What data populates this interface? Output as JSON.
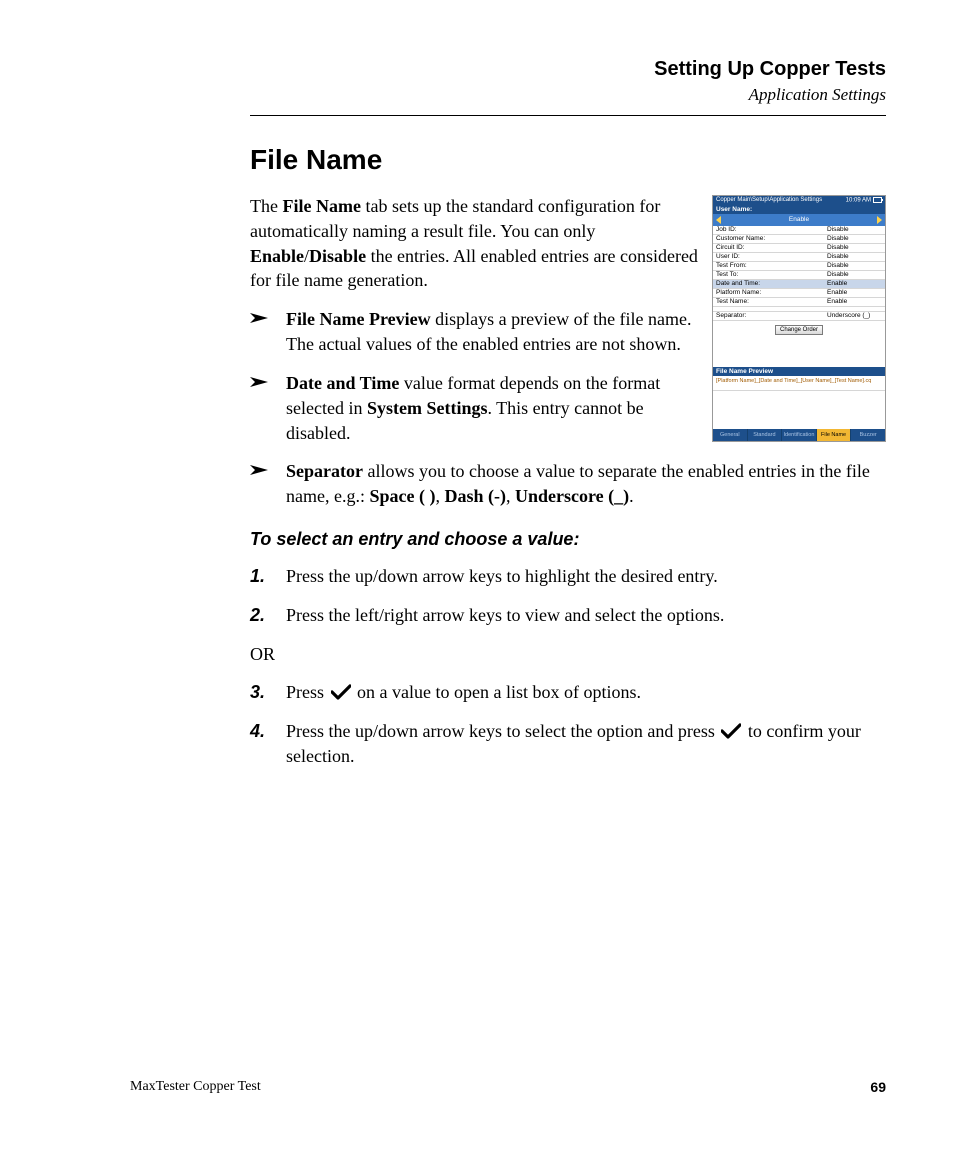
{
  "header": {
    "title": "Setting Up Copper Tests",
    "subtitle": "Application Settings"
  },
  "heading": "File Name",
  "intro": {
    "pre": "The ",
    "b1": "File Name",
    "mid1": " tab sets up the standard configuration for automatically naming a result file. You can only ",
    "b2": "Enable",
    "slash": "/",
    "b3": "Disable",
    "post": " the entries. All enabled entries are considered for file name generation."
  },
  "bullets": [
    {
      "b": "File Name Preview",
      "rest": " displays a preview of the file name. The actual values of the enabled entries are not shown."
    },
    {
      "b": "Date and Time",
      "mid": " value format depends on the format selected in ",
      "b2": "System Settings",
      "rest": ". This entry cannot be disabled."
    },
    {
      "b": "Separator",
      "mid": " allows you to choose a value to separate the enabled entries in the file name, e.g.: ",
      "s1": "Space ( )",
      "c1": ", ",
      "s2": "Dash (-)",
      "c2": ", ",
      "s3": "Underscore (_)",
      "end": "."
    }
  ],
  "procHeading": "To select an entry and choose a value:",
  "steps": {
    "n1": "1.",
    "t1": "Press the up/down arrow keys to highlight the desired entry.",
    "n2": "2.",
    "t2": "Press the left/right arrow keys to view and select the options.",
    "or": "OR",
    "n3": "3.",
    "t3a": "Press ",
    "t3b": " on a value to open a list box of options.",
    "n4": "4.",
    "t4a": "Press the up/down arrow keys to select the option and press ",
    "t4b": " to confirm your selection."
  },
  "footer": {
    "left": "MaxTester Copper Test",
    "page": "69"
  },
  "device": {
    "breadcrumb": "Copper Main\\Setup\\Application Settings",
    "time": "10:09 AM",
    "fieldLabel": "User Name:",
    "selectValue": "Enable",
    "rows": [
      {
        "k": "Job ID:",
        "v": "Disable",
        "sel": false
      },
      {
        "k": "Customer Name:",
        "v": "Disable",
        "sel": false
      },
      {
        "k": "Circuit ID:",
        "v": "Disable",
        "sel": false
      },
      {
        "k": "User ID:",
        "v": "Disable",
        "sel": false
      },
      {
        "k": "Test From:",
        "v": "Disable",
        "sel": false
      },
      {
        "k": "Test To:",
        "v": "Disable",
        "sel": false
      },
      {
        "k": "Date and Time:",
        "v": "Enable",
        "sel": true
      },
      {
        "k": "Platform Name:",
        "v": "Enable",
        "sel": false
      },
      {
        "k": "Test Name:",
        "v": "Enable",
        "sel": false
      }
    ],
    "separator": {
      "k": "Separator:",
      "v": "Underscore (_)"
    },
    "button": "Change Order",
    "previewHeading": "File Name Preview",
    "previewText": "[Platform Name]_[Date and Time]_[User Name]_[Test Name].cq",
    "tabs": [
      "General",
      "Standard",
      "Identification",
      "File Name",
      "Buzzer"
    ],
    "activeTab": 3
  }
}
